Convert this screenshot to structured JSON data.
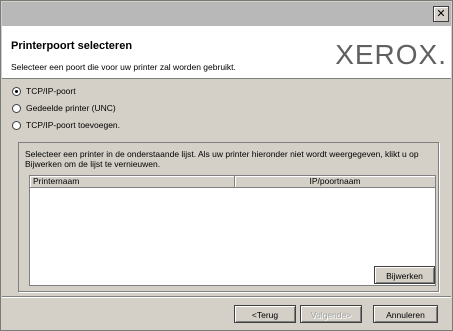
{
  "titlebar": {
    "close_glyph": "✕"
  },
  "header": {
    "title": "Printerpoort selecteren",
    "subtitle": "Selecteer een poort die voor uw printer zal worden gebruikt.",
    "logo": "XEROX."
  },
  "ports": [
    {
      "label": "TCP/IP-poort",
      "selected": true
    },
    {
      "label": "Gedeelde printer (UNC)",
      "selected": false
    },
    {
      "label": "TCP/IP-poort toevoegen.",
      "selected": false
    }
  ],
  "printer_panel": {
    "instructions": "Selecteer een printer in de onderstaande lijst. Als uw printer hieronder niet wordt weergegeven, klikt u op Bijwerken om de lijst te vernieuwen.",
    "columns": [
      "Printernaam",
      "IP/poortnaam"
    ],
    "rows": [],
    "refresh_label": "Bijwerken"
  },
  "footer": {
    "back_label": "<Terug",
    "next_label": "Volgende>",
    "cancel_label": "Annuleren"
  },
  "colors": {
    "background": "#d4d0c8",
    "header_bg": "#ffffff",
    "logo": "#606060"
  }
}
